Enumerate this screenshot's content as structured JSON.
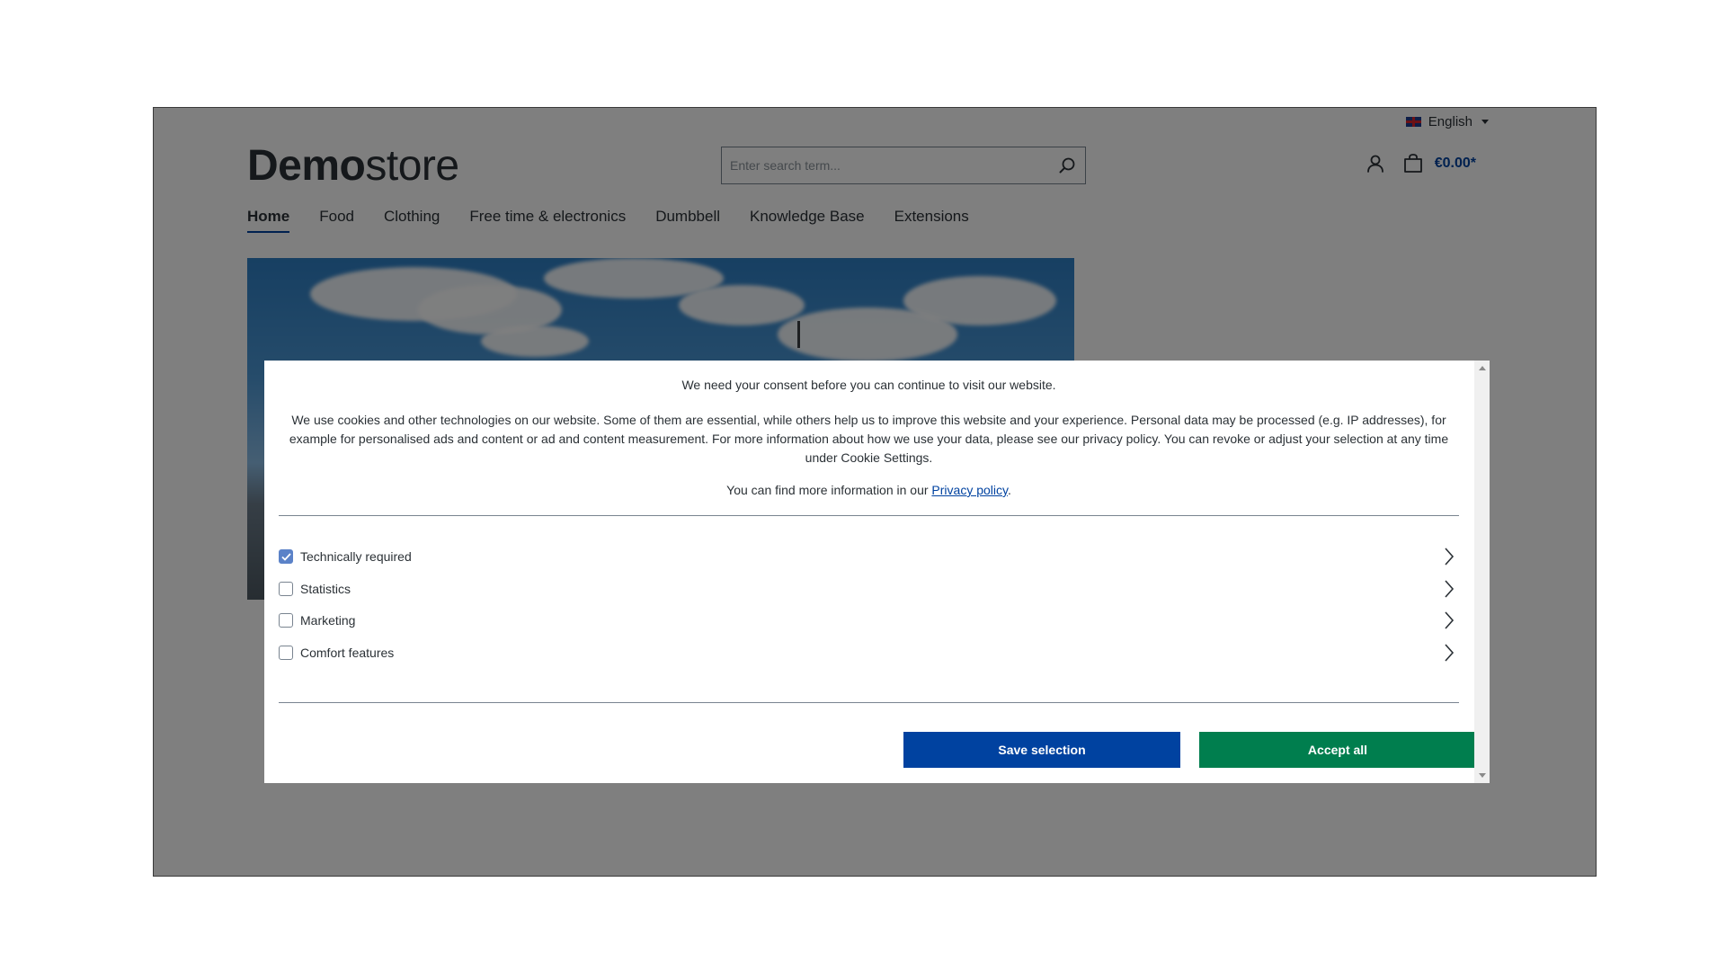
{
  "header": {
    "language": "English",
    "logo_bold": "Demo",
    "logo_light": "store",
    "search_placeholder": "Enter search term...",
    "cart_total": "€0.00*"
  },
  "nav": {
    "items": [
      {
        "label": "Home",
        "active": true
      },
      {
        "label": "Food"
      },
      {
        "label": "Clothing"
      },
      {
        "label": "Free time & electronics"
      },
      {
        "label": "Dumbbell"
      },
      {
        "label": "Knowledge Base"
      },
      {
        "label": "Extensions"
      }
    ]
  },
  "cookie_modal": {
    "title": "We need your consent before you can continue to visit our website.",
    "description": "We use cookies and other technologies on our website. Some of them are essential, while others help us to improve this website and your experience. Personal data may be processed (e.g. IP addresses), for example for personalised ads and content or ad and content measurement. For more information about how we use your data, please see our privacy policy. You can revoke or adjust your selection at any time under Cookie Settings.",
    "privacy_prefix": "You can find more information in our ",
    "privacy_link": "Privacy policy",
    "privacy_suffix": ".",
    "groups": [
      {
        "label": "Technically required",
        "checked": true
      },
      {
        "label": "Statistics",
        "checked": false
      },
      {
        "label": "Marketing",
        "checked": false
      },
      {
        "label": "Comfort features",
        "checked": false
      }
    ],
    "save_label": "Save selection",
    "accept_label": "Accept all"
  },
  "colors": {
    "primary": "#0042a0",
    "success": "#007e4e",
    "checkbox_checked": "#5b82c8",
    "overlay": "rgba(0,0,0,0.5)"
  },
  "icons": [
    "uk-flag-icon",
    "caret-down-icon",
    "search-icon",
    "user-icon",
    "cart-icon",
    "chevron-right-icon",
    "check-icon"
  ]
}
